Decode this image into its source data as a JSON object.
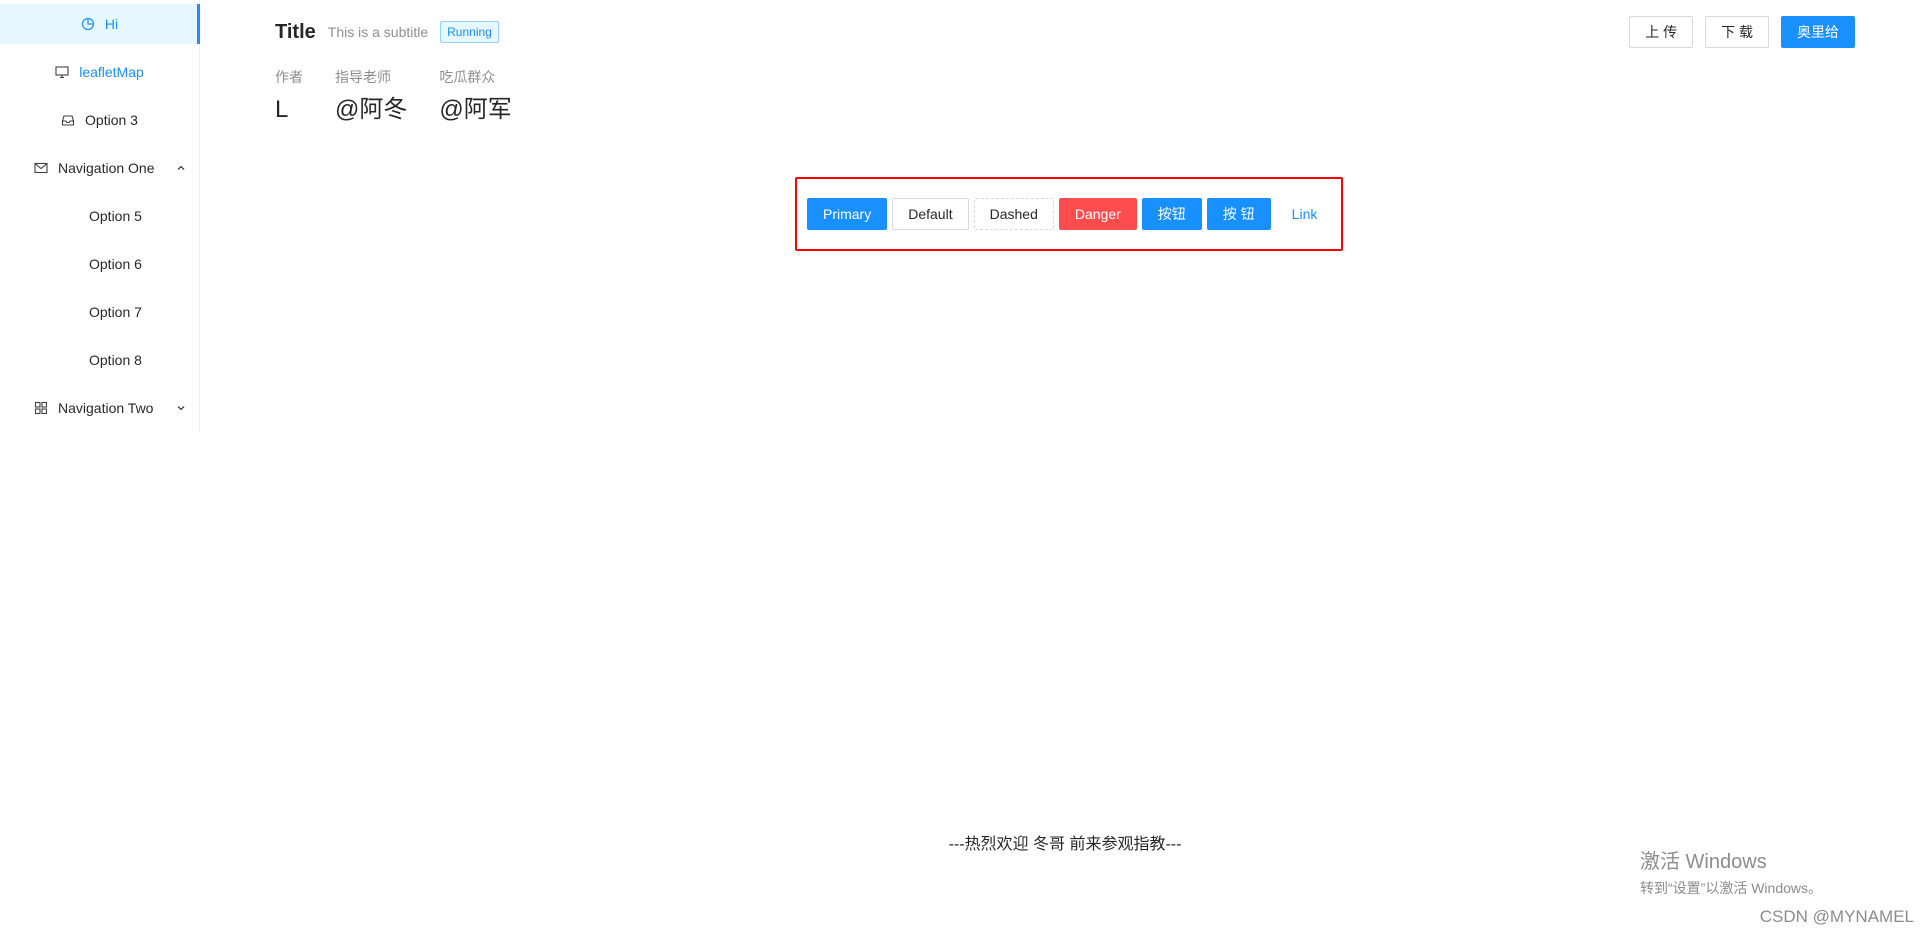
{
  "sidebar": {
    "items": [
      {
        "label": "Hi",
        "icon": "pie-chart-icon",
        "selected": true
      },
      {
        "label": "leafletMap",
        "icon": "desktop-icon"
      },
      {
        "label": "Option 3",
        "icon": "inbox-icon"
      }
    ],
    "nav_one": {
      "label": "Navigation One",
      "icon": "mail-icon",
      "expanded": true,
      "children": [
        "Option 5",
        "Option 6",
        "Option 7",
        "Option 8"
      ]
    },
    "nav_two": {
      "label": "Navigation Two",
      "icon": "appstore-icon",
      "expanded": false
    }
  },
  "header": {
    "title": "Title",
    "subtitle": "This is a subtitle",
    "tag": "Running",
    "actions": [
      "上 传",
      "下 载",
      "奥里给"
    ]
  },
  "stats": [
    {
      "title": "作者",
      "value": "L"
    },
    {
      "title": "指导老师",
      "value": "@阿冬"
    },
    {
      "title": "吃瓜群众",
      "value": "@阿军"
    }
  ],
  "buttons": {
    "primary": "Primary",
    "default": "Default",
    "dashed": "Dashed",
    "danger": "Danger",
    "btn1": "按钮",
    "btn2": "按 钮",
    "link": "Link"
  },
  "footer": "---热烈欢迎 冬哥 前来参观指教---",
  "watermark": {
    "line1": "激活 Windows",
    "line2": "转到“设置”以激活 Windows。"
  },
  "credit": "CSDN @MYNAMEL",
  "colors": {
    "primary": "#1890ff",
    "danger": "#ff4d4f",
    "highlight_border": "#ff0000",
    "selected_bg": "#e6f7ff"
  }
}
